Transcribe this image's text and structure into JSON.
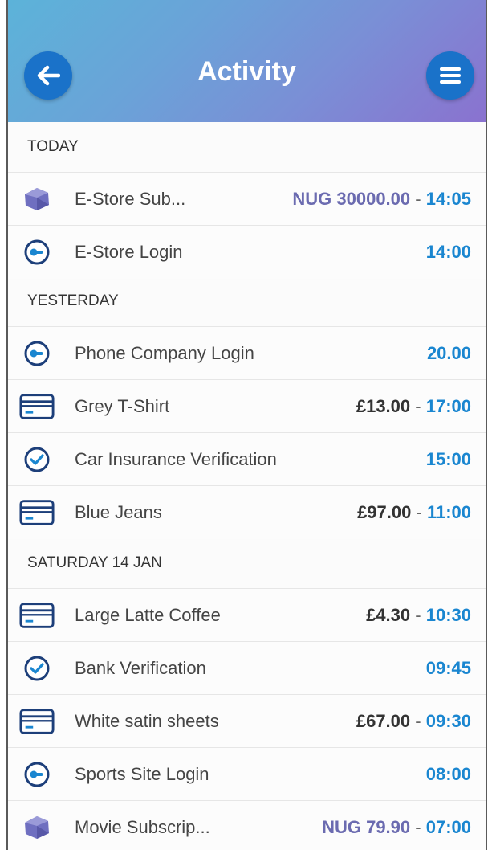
{
  "header": {
    "title": "Activity",
    "back_icon": "arrow-left-icon",
    "menu_icon": "hamburger-menu-icon",
    "accent": "#1a72c9"
  },
  "sections": [
    {
      "label": "TODAY",
      "items": [
        {
          "icon": "gem-icon",
          "title": "E-Store Sub...",
          "amount": "NUG 30000.00",
          "amount_type": "nug",
          "time": "14:05"
        },
        {
          "icon": "key-login-icon",
          "title": "E-Store Login",
          "amount": "",
          "amount_type": "",
          "time": "14:00"
        }
      ]
    },
    {
      "label": "YESTERDAY",
      "items": [
        {
          "icon": "key-login-icon",
          "title": "Phone Company Login",
          "amount": "",
          "amount_type": "",
          "time": "20.00"
        },
        {
          "icon": "credit-card-icon",
          "title": "Grey T-Shirt",
          "amount": "£13.00",
          "amount_type": "gbp",
          "time": "17:00"
        },
        {
          "icon": "check-circle-icon",
          "title": "Car Insurance Verification",
          "amount": "",
          "amount_type": "",
          "time": "15:00"
        },
        {
          "icon": "credit-card-icon",
          "title": "Blue Jeans",
          "amount": "£97.00",
          "amount_type": "gbp",
          "time": "11:00"
        }
      ]
    },
    {
      "label": "SATURDAY 14 JAN",
      "items": [
        {
          "icon": "credit-card-icon",
          "title": "Large Latte Coffee",
          "amount": "£4.30",
          "amount_type": "gbp",
          "time": "10:30"
        },
        {
          "icon": "check-circle-icon",
          "title": "Bank Verification",
          "amount": "",
          "amount_type": "",
          "time": "09:45"
        },
        {
          "icon": "credit-card-icon",
          "title": "White satin sheets",
          "amount": "£67.00",
          "amount_type": "gbp",
          "time": "09:30"
        },
        {
          "icon": "key-login-icon",
          "title": "Sports Site Login",
          "amount": "",
          "amount_type": "",
          "time": "08:00"
        },
        {
          "icon": "gem-icon",
          "title": "Movie Subscrip...",
          "amount": "NUG 79.90",
          "amount_type": "nug",
          "time": "07:00"
        }
      ]
    }
  ],
  "separator": "-"
}
